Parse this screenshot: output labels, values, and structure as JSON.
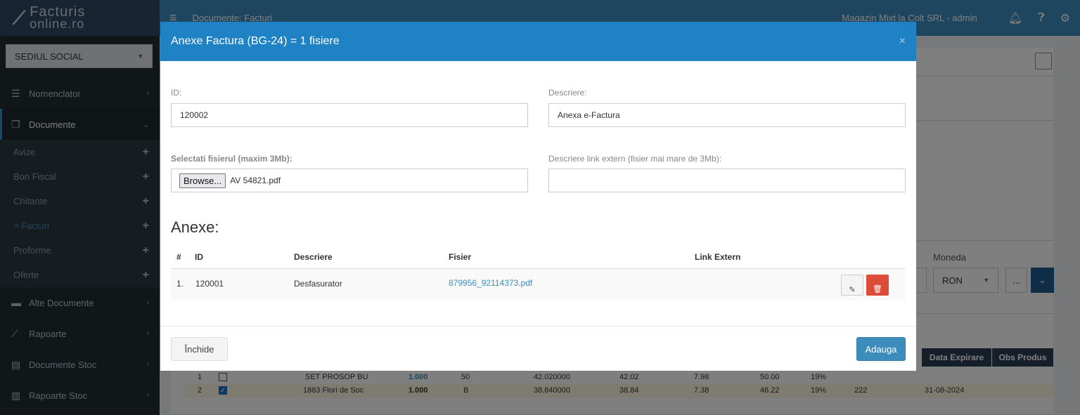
{
  "sidebar": {
    "logo_line1": "Facturis",
    "logo_line2": "online.ro",
    "branch": "SEDIUL SOCIAL",
    "items": [
      {
        "label": "Nomenclator"
      },
      {
        "label": "Documente"
      },
      {
        "label": "Alte Documente"
      },
      {
        "label": "Rapoarte"
      },
      {
        "label": "Documente Stoc"
      },
      {
        "label": "Rapoarte Stoc"
      }
    ],
    "sub_items": [
      {
        "label": "Avize"
      },
      {
        "label": "Bon Fiscal"
      },
      {
        "label": "Chitante"
      },
      {
        "label": "> Facturi"
      },
      {
        "label": "Proforme"
      },
      {
        "label": "Oferte"
      }
    ]
  },
  "topbar": {
    "breadcrumb": "Documente: Facturi",
    "user": "Magazin Mixt la Colt SRL - admin"
  },
  "background": {
    "moneda_label": "Moneda",
    "moneda_value": "RON",
    "dots_label": "...",
    "headers": [
      "Data Expirare",
      "Obs Produs"
    ],
    "rows": [
      {
        "nr": "1",
        "name": "SET PROSOP BU",
        "qty": "1.000",
        "um": "50",
        "price": "42.020000",
        "v1": "42.02",
        "v2": "7.98",
        "v3": "50.00",
        "vat": "19%",
        "lot": "",
        "exp": ""
      },
      {
        "nr": "2",
        "name": "1883 Flori de Soc",
        "qty": "1.000",
        "um": "B",
        "price": "38.840000",
        "v1": "38.84",
        "v2": "7.38",
        "v3": "46.22",
        "vat": "19%",
        "lot": "222",
        "exp": "31-08-2024"
      }
    ]
  },
  "modal": {
    "title": "Anexe Factura (BG-24) = 1 fisiere",
    "id_label": "ID:",
    "id_value": "120002",
    "desc_label": "Descriere:",
    "desc_value": "Anexa e-Factura",
    "file_label": "Selectati fisierul (maxim 3Mb):",
    "browse_label": "Browse...",
    "file_name": "AV 54821.pdf",
    "link_label": "Descriere link extern (fisier mai mare de 3Mb):",
    "link_value": "",
    "anexe_title": "Anexe:",
    "table_headers": [
      "#",
      "ID",
      "Descriere",
      "Fisier",
      "Link Extern"
    ],
    "rows": [
      {
        "nr": "1.",
        "id": "120001",
        "desc": "Desfasurator",
        "file": "879956_92114373.pdf",
        "link": ""
      }
    ],
    "close_label": "Închide",
    "add_label": "Adauga"
  }
}
